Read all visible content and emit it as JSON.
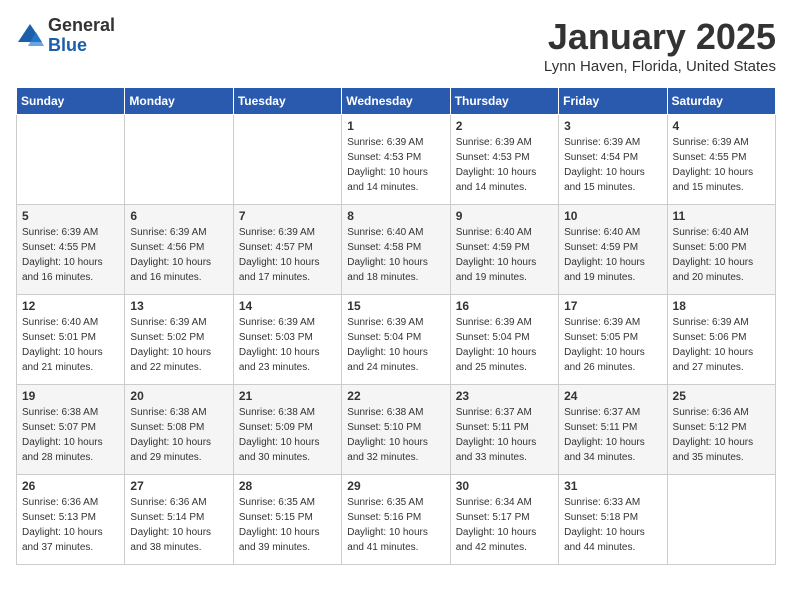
{
  "header": {
    "logo_line1": "General",
    "logo_line2": "Blue",
    "month": "January 2025",
    "location": "Lynn Haven, Florida, United States"
  },
  "days_of_week": [
    "Sunday",
    "Monday",
    "Tuesday",
    "Wednesday",
    "Thursday",
    "Friday",
    "Saturday"
  ],
  "weeks": [
    [
      {
        "day": "",
        "sunrise": "",
        "sunset": "",
        "daylight": ""
      },
      {
        "day": "",
        "sunrise": "",
        "sunset": "",
        "daylight": ""
      },
      {
        "day": "",
        "sunrise": "",
        "sunset": "",
        "daylight": ""
      },
      {
        "day": "1",
        "sunrise": "Sunrise: 6:39 AM",
        "sunset": "Sunset: 4:53 PM",
        "daylight": "Daylight: 10 hours and 14 minutes."
      },
      {
        "day": "2",
        "sunrise": "Sunrise: 6:39 AM",
        "sunset": "Sunset: 4:53 PM",
        "daylight": "Daylight: 10 hours and 14 minutes."
      },
      {
        "day": "3",
        "sunrise": "Sunrise: 6:39 AM",
        "sunset": "Sunset: 4:54 PM",
        "daylight": "Daylight: 10 hours and 15 minutes."
      },
      {
        "day": "4",
        "sunrise": "Sunrise: 6:39 AM",
        "sunset": "Sunset: 4:55 PM",
        "daylight": "Daylight: 10 hours and 15 minutes."
      }
    ],
    [
      {
        "day": "5",
        "sunrise": "Sunrise: 6:39 AM",
        "sunset": "Sunset: 4:55 PM",
        "daylight": "Daylight: 10 hours and 16 minutes."
      },
      {
        "day": "6",
        "sunrise": "Sunrise: 6:39 AM",
        "sunset": "Sunset: 4:56 PM",
        "daylight": "Daylight: 10 hours and 16 minutes."
      },
      {
        "day": "7",
        "sunrise": "Sunrise: 6:39 AM",
        "sunset": "Sunset: 4:57 PM",
        "daylight": "Daylight: 10 hours and 17 minutes."
      },
      {
        "day": "8",
        "sunrise": "Sunrise: 6:40 AM",
        "sunset": "Sunset: 4:58 PM",
        "daylight": "Daylight: 10 hours and 18 minutes."
      },
      {
        "day": "9",
        "sunrise": "Sunrise: 6:40 AM",
        "sunset": "Sunset: 4:59 PM",
        "daylight": "Daylight: 10 hours and 19 minutes."
      },
      {
        "day": "10",
        "sunrise": "Sunrise: 6:40 AM",
        "sunset": "Sunset: 4:59 PM",
        "daylight": "Daylight: 10 hours and 19 minutes."
      },
      {
        "day": "11",
        "sunrise": "Sunrise: 6:40 AM",
        "sunset": "Sunset: 5:00 PM",
        "daylight": "Daylight: 10 hours and 20 minutes."
      }
    ],
    [
      {
        "day": "12",
        "sunrise": "Sunrise: 6:40 AM",
        "sunset": "Sunset: 5:01 PM",
        "daylight": "Daylight: 10 hours and 21 minutes."
      },
      {
        "day": "13",
        "sunrise": "Sunrise: 6:39 AM",
        "sunset": "Sunset: 5:02 PM",
        "daylight": "Daylight: 10 hours and 22 minutes."
      },
      {
        "day": "14",
        "sunrise": "Sunrise: 6:39 AM",
        "sunset": "Sunset: 5:03 PM",
        "daylight": "Daylight: 10 hours and 23 minutes."
      },
      {
        "day": "15",
        "sunrise": "Sunrise: 6:39 AM",
        "sunset": "Sunset: 5:04 PM",
        "daylight": "Daylight: 10 hours and 24 minutes."
      },
      {
        "day": "16",
        "sunrise": "Sunrise: 6:39 AM",
        "sunset": "Sunset: 5:04 PM",
        "daylight": "Daylight: 10 hours and 25 minutes."
      },
      {
        "day": "17",
        "sunrise": "Sunrise: 6:39 AM",
        "sunset": "Sunset: 5:05 PM",
        "daylight": "Daylight: 10 hours and 26 minutes."
      },
      {
        "day": "18",
        "sunrise": "Sunrise: 6:39 AM",
        "sunset": "Sunset: 5:06 PM",
        "daylight": "Daylight: 10 hours and 27 minutes."
      }
    ],
    [
      {
        "day": "19",
        "sunrise": "Sunrise: 6:38 AM",
        "sunset": "Sunset: 5:07 PM",
        "daylight": "Daylight: 10 hours and 28 minutes."
      },
      {
        "day": "20",
        "sunrise": "Sunrise: 6:38 AM",
        "sunset": "Sunset: 5:08 PM",
        "daylight": "Daylight: 10 hours and 29 minutes."
      },
      {
        "day": "21",
        "sunrise": "Sunrise: 6:38 AM",
        "sunset": "Sunset: 5:09 PM",
        "daylight": "Daylight: 10 hours and 30 minutes."
      },
      {
        "day": "22",
        "sunrise": "Sunrise: 6:38 AM",
        "sunset": "Sunset: 5:10 PM",
        "daylight": "Daylight: 10 hours and 32 minutes."
      },
      {
        "day": "23",
        "sunrise": "Sunrise: 6:37 AM",
        "sunset": "Sunset: 5:11 PM",
        "daylight": "Daylight: 10 hours and 33 minutes."
      },
      {
        "day": "24",
        "sunrise": "Sunrise: 6:37 AM",
        "sunset": "Sunset: 5:11 PM",
        "daylight": "Daylight: 10 hours and 34 minutes."
      },
      {
        "day": "25",
        "sunrise": "Sunrise: 6:36 AM",
        "sunset": "Sunset: 5:12 PM",
        "daylight": "Daylight: 10 hours and 35 minutes."
      }
    ],
    [
      {
        "day": "26",
        "sunrise": "Sunrise: 6:36 AM",
        "sunset": "Sunset: 5:13 PM",
        "daylight": "Daylight: 10 hours and 37 minutes."
      },
      {
        "day": "27",
        "sunrise": "Sunrise: 6:36 AM",
        "sunset": "Sunset: 5:14 PM",
        "daylight": "Daylight: 10 hours and 38 minutes."
      },
      {
        "day": "28",
        "sunrise": "Sunrise: 6:35 AM",
        "sunset": "Sunset: 5:15 PM",
        "daylight": "Daylight: 10 hours and 39 minutes."
      },
      {
        "day": "29",
        "sunrise": "Sunrise: 6:35 AM",
        "sunset": "Sunset: 5:16 PM",
        "daylight": "Daylight: 10 hours and 41 minutes."
      },
      {
        "day": "30",
        "sunrise": "Sunrise: 6:34 AM",
        "sunset": "Sunset: 5:17 PM",
        "daylight": "Daylight: 10 hours and 42 minutes."
      },
      {
        "day": "31",
        "sunrise": "Sunrise: 6:33 AM",
        "sunset": "Sunset: 5:18 PM",
        "daylight": "Daylight: 10 hours and 44 minutes."
      },
      {
        "day": "",
        "sunrise": "",
        "sunset": "",
        "daylight": ""
      }
    ]
  ]
}
